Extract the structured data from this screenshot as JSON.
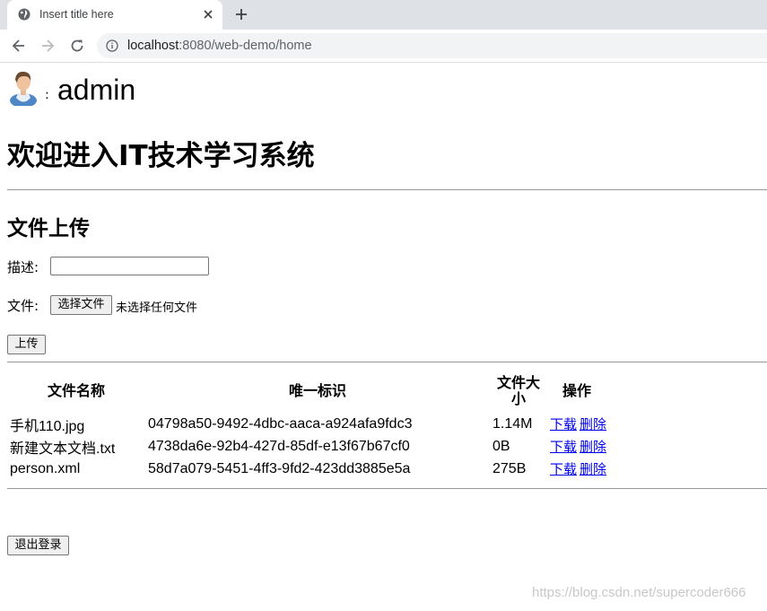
{
  "browser": {
    "tab_title": "Insert title here",
    "url_host": "localhost",
    "url_path": ":8080/web-demo/home"
  },
  "user": {
    "colon": ":",
    "name": "admin"
  },
  "page": {
    "title": "欢迎进入IT技术学习系统",
    "upload_section_title": "文件上传",
    "description_label": "描述:",
    "description_value": "",
    "file_label": "文件:",
    "choose_file_button": "选择文件",
    "no_file_selected": "未选择任何文件",
    "upload_button": "上传",
    "logout_button": "退出登录"
  },
  "table": {
    "headers": [
      "文件名称",
      "唯一标识",
      "文件大小",
      "操作"
    ],
    "rows": [
      {
        "name": "手机110.jpg",
        "id": "04798a50-9492-4dbc-aaca-a924afa9fdc3",
        "size": "1.14M",
        "download": "下载",
        "delete": "删除"
      },
      {
        "name": "新建文本文档.txt",
        "id": "4738da6e-92b4-427d-85df-e13f67b67cf0",
        "size": "0B",
        "download": "下载",
        "delete": "删除"
      },
      {
        "name": "person.xml",
        "id": "58d7a079-5451-4ff3-9fd2-423dd3885e5a",
        "size": "275B",
        "download": "下载",
        "delete": "删除"
      }
    ]
  },
  "watermark": "https://blog.csdn.net/supercoder666",
  "colors": {
    "link": "#0000ee",
    "chrome_bg": "#dee1e6",
    "omnibox_bg": "#f1f3f4"
  }
}
